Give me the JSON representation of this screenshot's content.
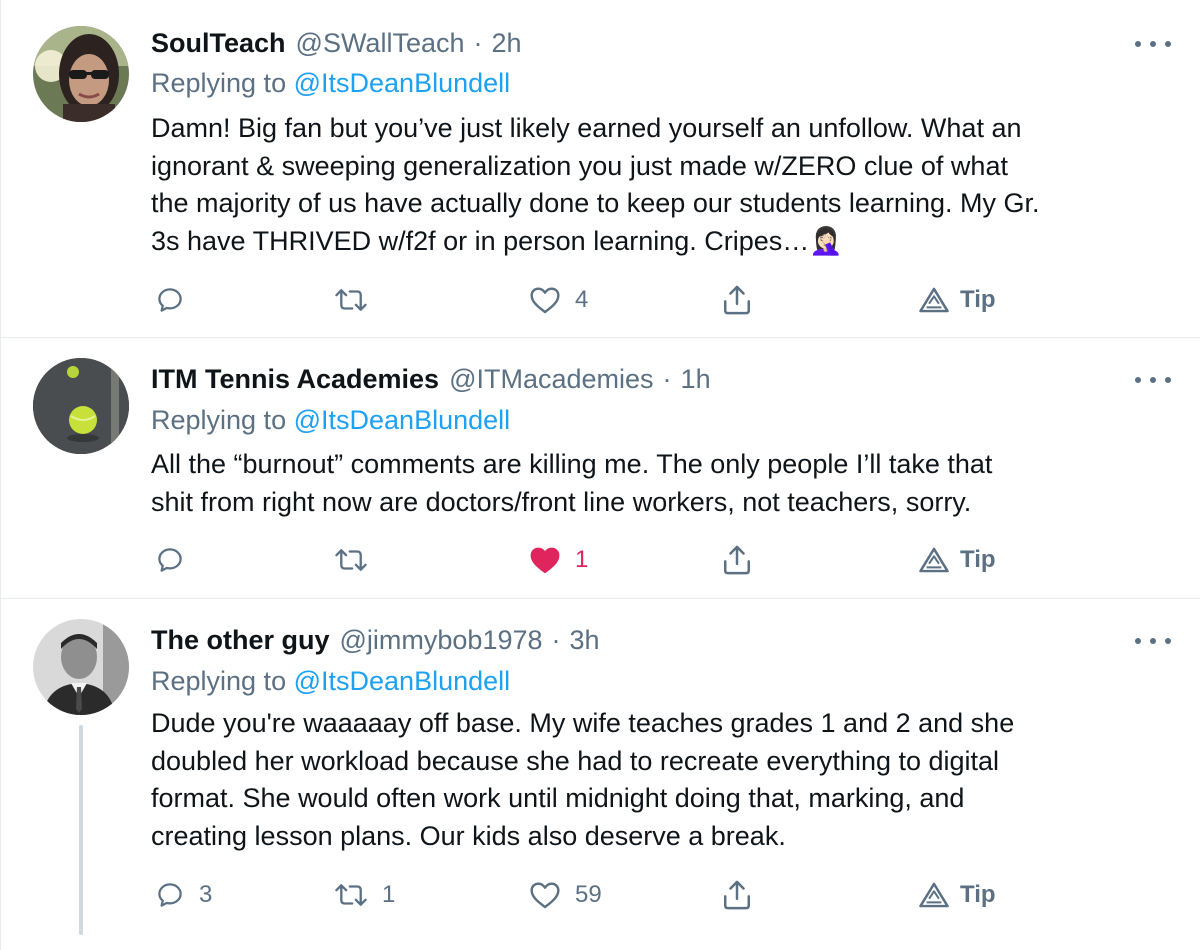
{
  "tweets": [
    {
      "name": "SoulTeach",
      "handle": "@SWallTeach",
      "dot": "·",
      "time": "2h",
      "replying_prefix": "Replying to",
      "replying_to": "@ItsDeanBlundell",
      "body_lines": [
        "Damn!  Big fan but you’ve just likely earned yourself an unfollow. What an",
        "ignorant & sweeping generalization you just made w/ZERO clue of what",
        "the majority of us have actually done to keep our students learning. My Gr.",
        "3s have THRIVED w/f2f or in person learning.  Cripes…🤦🏻‍♀️"
      ],
      "actions": {
        "reply_count": "",
        "retweet_count": "",
        "like_count": "4",
        "liked": false,
        "tip_label": "Tip"
      },
      "avatar_icon": "sunglasses-woman-avatar"
    },
    {
      "name": "ITM Tennis Academies",
      "handle": "@ITMacademies",
      "dot": "·",
      "time": "1h",
      "replying_prefix": "Replying to",
      "replying_to": "@ItsDeanBlundell",
      "body_lines": [
        "All the “burnout” comments are killing me. The only people I’ll take that",
        "shit from right now are doctors/front line workers, not teachers, sorry."
      ],
      "actions": {
        "reply_count": "",
        "retweet_count": "",
        "like_count": "1",
        "liked": true,
        "tip_label": "Tip"
      },
      "avatar_icon": "tennis-ball-avatar"
    },
    {
      "name": "The other guy",
      "handle": "@jimmybob1978",
      "dot": "·",
      "time": "3h",
      "replying_prefix": "Replying to",
      "replying_to": "@ItsDeanBlundell",
      "body_lines": [
        "Dude you're waaaaay off base. My wife teaches grades 1 and 2 and she",
        "doubled her workload because she had to recreate everything to digital",
        "format. She would often work until midnight doing that, marking, and",
        "creating lesson plans. Our kids also deserve a break."
      ],
      "actions": {
        "reply_count": "3",
        "retweet_count": "1",
        "like_count": "59",
        "liked": false,
        "tip_label": "Tip"
      },
      "avatar_icon": "man-in-suit-avatar"
    }
  ],
  "colors": {
    "text_primary": "#0f1419",
    "text_secondary": "#5b7083",
    "link": "#1da1f2",
    "like_active": "#e0245e",
    "divider": "#e6ecf0",
    "thread_line": "#cfd9de"
  }
}
